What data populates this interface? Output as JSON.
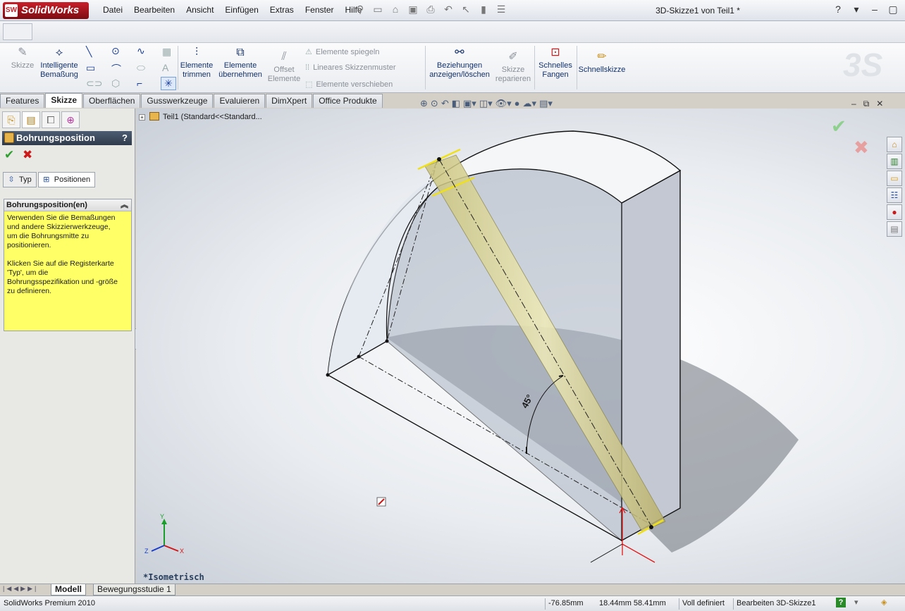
{
  "app": {
    "logo_text": "SolidWorks",
    "logo_badge": "SW",
    "document_title": "3D-Skizze1 von Teil1 *",
    "menu": [
      "Datei",
      "Bearbeiten",
      "Ansicht",
      "Einfügen",
      "Extras",
      "Fenster",
      "Hilfe"
    ],
    "window_controls": [
      "?",
      "▾",
      "–",
      "▢",
      "✕"
    ]
  },
  "ribbon": {
    "sketch": "Skizze",
    "smart_dimension": [
      "Intelligente",
      "Bemaßung"
    ],
    "trim": [
      "Elemente",
      "trimmen"
    ],
    "convert": [
      "Elemente",
      "übernehmen"
    ],
    "offset": [
      "Offset",
      "Elemente"
    ],
    "mirror": "Elemente spiegeln",
    "linear_pattern": "Lineares Skizzenmuster",
    "move": "Elemente verschieben",
    "relations": [
      "Beziehungen",
      "anzeigen/löschen"
    ],
    "repair": [
      "Skizze",
      "reparieren"
    ],
    "snap": [
      "Schnelles",
      "Fangen"
    ],
    "quick_sketch": "Schnellskizze"
  },
  "tabs": [
    "Features",
    "Skizze",
    "Oberflächen",
    "Gusswerkzeuge",
    "Evaluieren",
    "DimXpert",
    "Office Produkte"
  ],
  "active_tab": "Skizze",
  "property_manager": {
    "title": "Bohrungsposition",
    "help": "?",
    "subtabs": [
      "Typ",
      "Positionen"
    ],
    "group_title": "Bohrungsposition(en)",
    "help_text": "Verwenden Sie die Bemaßungen\nund andere Skizzierwerkzeuge,\num die Bohrungsmitte zu\npositionieren.\n\nKlicken Sie auf die Registerkarte\n'Typ', um die\nBohrungsspezifikation und -größe\nzu definieren."
  },
  "viewport": {
    "tree_item": "Teil1  (Standard<<Standard...",
    "dimension": "45°",
    "view_label": "*Isometrisch",
    "triad": {
      "y": "Y",
      "x": "X",
      "z": "Z"
    }
  },
  "bottom_tabs": [
    "Modell",
    "Bewegungsstudie 1"
  ],
  "status": {
    "product": "SolidWorks Premium 2010",
    "x": "-76.85mm",
    "yz": "18.44mm 58.41mm",
    "state": "Voll definiert",
    "mode": "Bearbeiten 3D-Skizze1",
    "help": "?"
  },
  "colors": {
    "accent_blue": "#13316b",
    "help_yellow": "#ffff66",
    "hole_yellow": "#d8d48a",
    "ok_green": "#2fa02f",
    "cancel_red": "#cc1a1a"
  }
}
